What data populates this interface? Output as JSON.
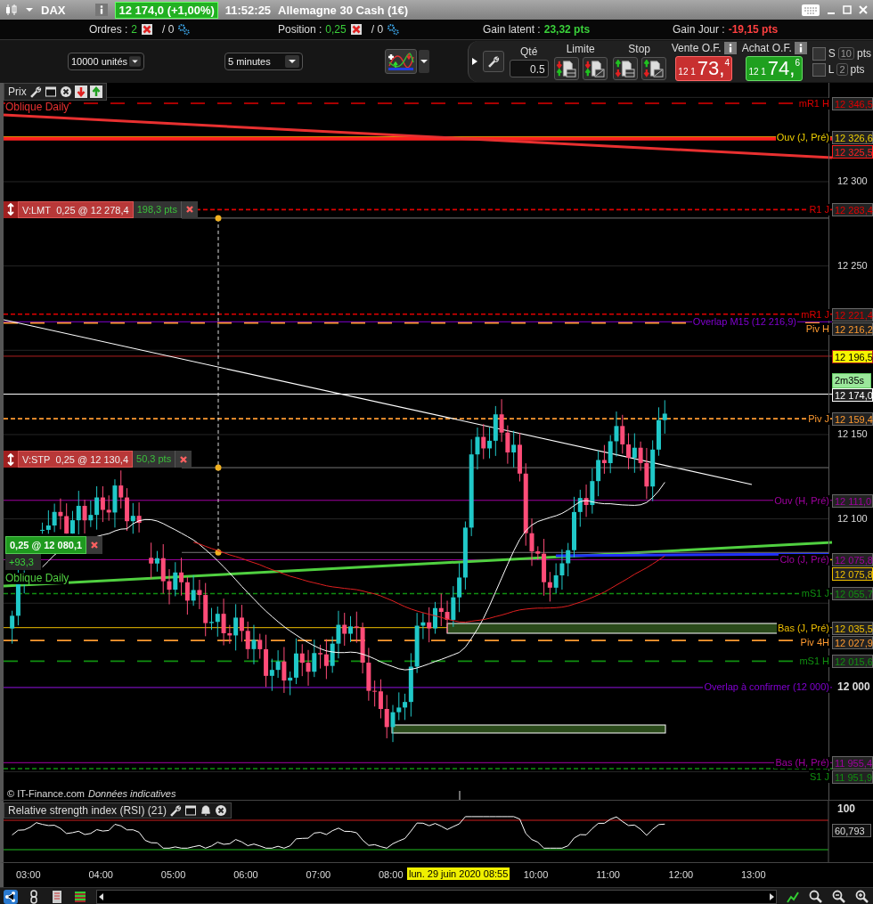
{
  "window": {
    "symbol": "DAX",
    "quote": "12 174,0 (+1,00%)",
    "time": "11:52:25",
    "title": "Allemagne 30 Cash (1€)"
  },
  "summary": {
    "orders_label": "Ordres :",
    "orders_count": "2",
    "orders_auto": "/ 0",
    "position_label": "Position :",
    "position_value": "0,25",
    "position_auto": "/ 0",
    "gain_latent_label": "Gain latent :",
    "gain_latent": "23,32 pts",
    "gain_jour_label": "Gain Jour :",
    "gain_jour": "-19,15 pts"
  },
  "toolbar": {
    "units": "10000 unités",
    "period": "5 minutes",
    "qty_label": "Qté",
    "qty": "0.5",
    "limit_label": "Limite",
    "stop_label": "Stop",
    "sell": {
      "label": "Vente O.F.",
      "prefix": "12 1",
      "big": "73,",
      "small": "4"
    },
    "buy": {
      "label": "Achat O.F.",
      "prefix": "12 1",
      "big": "74,",
      "small": "6"
    },
    "offsets": [
      {
        "label": "S",
        "value": "10",
        "unit": "pts",
        "checked": false
      },
      {
        "label": "L",
        "value": "2",
        "unit": "pts",
        "checked": false
      }
    ]
  },
  "chart": {
    "panel_label": "Prix",
    "axis_ticks": [
      "12 300",
      "12 250",
      "12 150",
      "12 100",
      "12 000"
    ],
    "price_levels": [
      {
        "label": "mR1 H",
        "value": "12 346,5",
        "color": "#e00000",
        "kind": "longdash",
        "highlighted": false
      },
      {
        "label": "Ouv (J, Pré)",
        "value": "12 326,6",
        "color": "#f0d000",
        "kind": "solid",
        "highlighted": false
      },
      {
        "value": "12 325,5",
        "color": "#ff2020",
        "kind": "thick",
        "highlighted": false
      },
      {
        "label": "R1 J",
        "value": "12 283,4",
        "color": "#e00000",
        "kind": "dashed",
        "highlighted": false
      },
      {
        "label": "mR1 J",
        "value": "12 221,4",
        "color": "#e00000",
        "kind": "dashed",
        "highlighted": false
      },
      {
        "label": "Overlap M15 (12 216,9)",
        "color": "#8000d0",
        "kind": "solid"
      },
      {
        "label": "Piv H",
        "value": "12 216,2",
        "color": "#ff9a30",
        "kind": "longdash",
        "highlighted": false
      },
      {
        "value": "12 196,5",
        "color": "#b02020",
        "kind": "solid",
        "highlighted": true
      },
      {
        "value": "12 174,0",
        "color": "#ffffff",
        "kind": "solid",
        "highlighted": false,
        "timer": "2m35s"
      },
      {
        "label": "Piv J",
        "value": "12 159,4",
        "color": "#ff9a30",
        "kind": "dashed",
        "highlighted": false
      },
      {
        "label": "Ouv (H, Pré)",
        "value": "12 111,0",
        "color": "#a000a0",
        "kind": "solid",
        "highlighted": false
      },
      {
        "label": "Clo (J, Pré)",
        "value": "12 075,8",
        "color": "#a000a0",
        "kind": "solid",
        "highlighted": false
      },
      {
        "value": "12 075,8",
        "color": "#f0c000",
        "kind": "none",
        "highlighted": false
      },
      {
        "label": "mS1 J",
        "value": "12 055,7",
        "color": "#109010",
        "kind": "dashed",
        "highlighted": false
      },
      {
        "label": "Bas (J, Pré)",
        "value": "12 035,5",
        "color": "#f0c000",
        "kind": "solid",
        "highlighted": false
      },
      {
        "label": "Piv 4H",
        "value": "12 027,9",
        "color": "#ff9a30",
        "kind": "longdash",
        "highlighted": false
      },
      {
        "label": "mS1 H",
        "value": "12 015,6",
        "color": "#109010",
        "kind": "longdash",
        "highlighted": false
      },
      {
        "label": "Overlap à confirmer (12 000)",
        "color": "#8000d0",
        "kind": "solid"
      },
      {
        "label": "Bas (H, Pré)",
        "value": "11 955,4",
        "color": "#a000a0",
        "kind": "solid",
        "highlighted": false
      },
      {
        "label": "S1 J",
        "value": "11 951,9",
        "color": "#109010",
        "kind": "dashed",
        "highlighted": false
      }
    ],
    "trend_lines": [
      {
        "label": "Oblique Daily",
        "color": "#e83030"
      },
      {
        "label": "Oblique Daily",
        "color": "#50d040"
      }
    ],
    "orders": [
      {
        "type": "V:LMT",
        "detail": "0,25 @ 12 278,4",
        "gain": "198,3 pts"
      },
      {
        "type": "V:STP",
        "detail": "0,25 @ 12 130,4",
        "gain": "50,3 pts"
      }
    ],
    "position": {
      "detail": "0,25 @ 12 080,1",
      "gain": "+93,3"
    },
    "footnote_source": "© IT-Finance.com",
    "footnote_note": "Données indicatives"
  },
  "rsi": {
    "label": "Relative strength index (RSI) (21)",
    "top_tick": "100",
    "value": "60,793"
  },
  "time_axis": {
    "ticks": [
      "03:00",
      "04:00",
      "05:00",
      "06:00",
      "07:00",
      "08:00",
      "10:00",
      "11:00",
      "12:00",
      "13:00"
    ],
    "cursor": "lun. 29 juin 2020 08:55"
  }
}
